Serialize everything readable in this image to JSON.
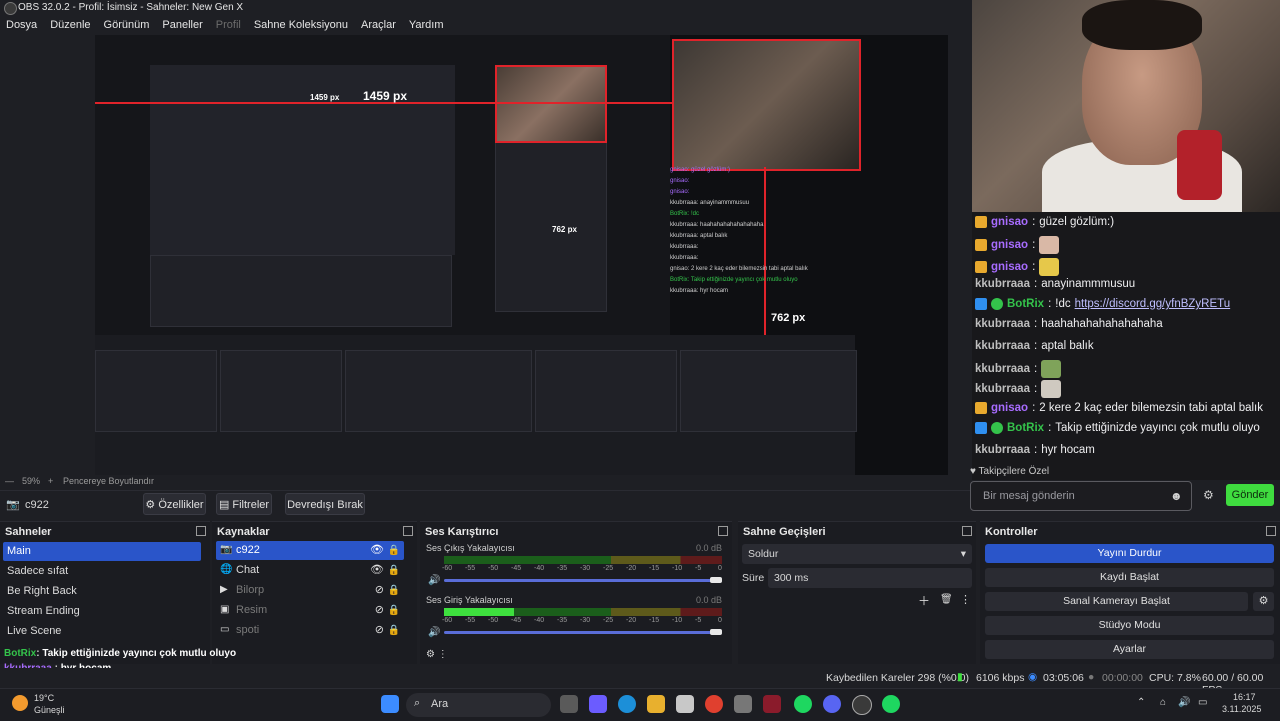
{
  "window": {
    "title": "OBS 32.0.2 - Profil: İsimsiz - Sahneler: New Gen X"
  },
  "menu": [
    "Dosya",
    "Düzenle",
    "Görünüm",
    "Paneller",
    "Profil",
    "Sahne Koleksiyonu",
    "Araçlar",
    "Yardım"
  ],
  "preview": {
    "guide_top": "1459 px",
    "guide_mid": "1459 px",
    "guide_right": "762 px",
    "guide_inner": "762 px",
    "zoom": "59%",
    "fit_label": "Pencereye Boyutlandır"
  },
  "source_toolbar": {
    "selected_source": "c922",
    "properties": "Özellikler",
    "filters": "Filtreler",
    "disable": "Devredışı Bırak"
  },
  "scenes": {
    "title": "Sahneler",
    "items": [
      "Main",
      "Sadece sıfat",
      "Be Right Back",
      "Stream Ending",
      "Live Scene"
    ]
  },
  "sources": {
    "title": "Kaynaklar",
    "items": [
      {
        "name": "c922",
        "icon": "camera-icon"
      },
      {
        "name": "Chat",
        "icon": "browser-icon"
      },
      {
        "name": "Bilorp",
        "icon": "media-icon"
      },
      {
        "name": "Resim",
        "icon": "image-icon"
      },
      {
        "name": "spoti",
        "icon": "window-icon"
      }
    ]
  },
  "mixer": {
    "title": "Ses Karıştırıcı",
    "channels": [
      {
        "name": "Ses Çıkış Yakalayıcısı",
        "db": "0.0 dB",
        "level": 0
      },
      {
        "name": "Ses Giriş Yakalayıcısı",
        "db": "0.0 dB",
        "level": 0.25
      }
    ],
    "scale": [
      "-60",
      "-55",
      "-50",
      "-45",
      "-40",
      "-35",
      "-30",
      "-25",
      "-20",
      "-15",
      "-10",
      "-5",
      "0"
    ]
  },
  "transitions": {
    "title": "Sahne Geçişleri",
    "selected": "Soldur",
    "duration_label": "Süre",
    "duration_value": "300 ms"
  },
  "controls": {
    "title": "Kontroller",
    "buttons": [
      "Yayını Durdur",
      "Kaydı Başlat",
      "Sanal Kamerayı Başlat",
      "Stüdyo Modu",
      "Ayarlar"
    ]
  },
  "status": {
    "dropped": "Kaybedilen Kareler 298 (%0.0)",
    "bitrate": "6106 kbps",
    "live_time": "03:05:06",
    "rec_time": "00:00:00",
    "cpu": "CPU: 7.8%",
    "fps": "60.00 / 60.00 FPS"
  },
  "chat": {
    "messages": [
      {
        "user": "gnisao",
        "text": "güzel gözlüm:)",
        "badges": [
          "sub"
        ]
      },
      {
        "user": "gnisao",
        "text": "",
        "badges": [
          "sub"
        ],
        "emote": "cat-emote"
      },
      {
        "user": "gnisao",
        "text": "",
        "badges": [
          "sub"
        ],
        "emote": "banana-emote"
      },
      {
        "user": "kkubrraaa",
        "text": "anayinammmusuu",
        "badges": []
      },
      {
        "user": "BotRix",
        "text": "!dc ",
        "link": "https://discord.gg/yfnBZyRETu",
        "badges": [
          "bot",
          "mod"
        ]
      },
      {
        "user": "kkubrraaa",
        "text": "haahahahahahahahaha",
        "badges": []
      },
      {
        "user": "kkubrraaa",
        "text": "aptal balık",
        "badges": []
      },
      {
        "user": "kkubrraaa",
        "text": "",
        "badges": [],
        "emote": "frog-emote"
      },
      {
        "user": "kkubrraaa",
        "text": "",
        "badges": [],
        "emote": "cat2-emote"
      },
      {
        "user": "gnisao",
        "text": "2 kere 2 kaç eder bilemezsin tabi aptal balık",
        "badges": [
          "sub"
        ]
      },
      {
        "user": "BotRix",
        "text": "Takip ettiğinizde yayıncı çok mutlu oluyo",
        "badges": [
          "bot",
          "mod"
        ]
      },
      {
        "user": "kkubrraaa",
        "text": "hyr hocam",
        "badges": []
      }
    ],
    "follow_mode": "Takipçilere Özel",
    "input_placeholder": "Bir mesaj gönderin",
    "send": "Gönder"
  },
  "overlay_chat": [
    {
      "user": "BotRix",
      "text": "Takip ettiğinizde yayıncı çok mutlu oluyo"
    },
    {
      "user": "kkubrraaa",
      "text": "hyr hocam"
    }
  ],
  "taskbar": {
    "weather_temp": "19°C",
    "weather_desc": "Güneşli",
    "search": "Ara",
    "time": "16:17",
    "date": "3.11.2025"
  },
  "colors": {
    "accent": "#2a55c9",
    "guide": "#e0232a",
    "send": "#3fdc3f"
  }
}
